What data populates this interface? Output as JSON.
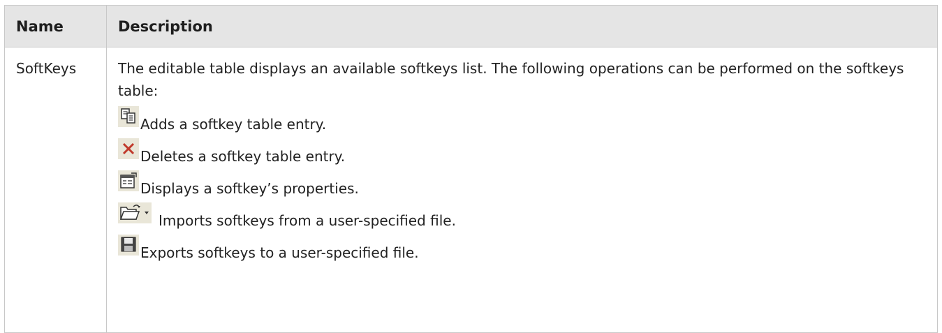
{
  "table": {
    "headers": {
      "name": "Name",
      "description": "Description"
    },
    "rows": [
      {
        "name": "SoftKeys",
        "intro": "The editable table displays an available softkeys list. The following operations can be performed on the softkeys table:",
        "operations": [
          {
            "icon": "copy-icon",
            "text": "Adds a softkey table entry."
          },
          {
            "icon": "delete-x-icon",
            "text": "Deletes a softkey table entry."
          },
          {
            "icon": "properties-icon",
            "text": "Displays a softkey’s properties."
          },
          {
            "icon": "open-folder-dropdown-icon",
            "text": "Imports softkeys from a user-specified file."
          },
          {
            "icon": "save-floppy-icon",
            "text": "Exports softkeys to a user-specified file."
          }
        ]
      }
    ]
  },
  "colors": {
    "header_bg": "#e5e5e5",
    "border": "#c8c8c8",
    "icon_bg": "#e9e6d8",
    "delete_red": "#c0392b"
  }
}
